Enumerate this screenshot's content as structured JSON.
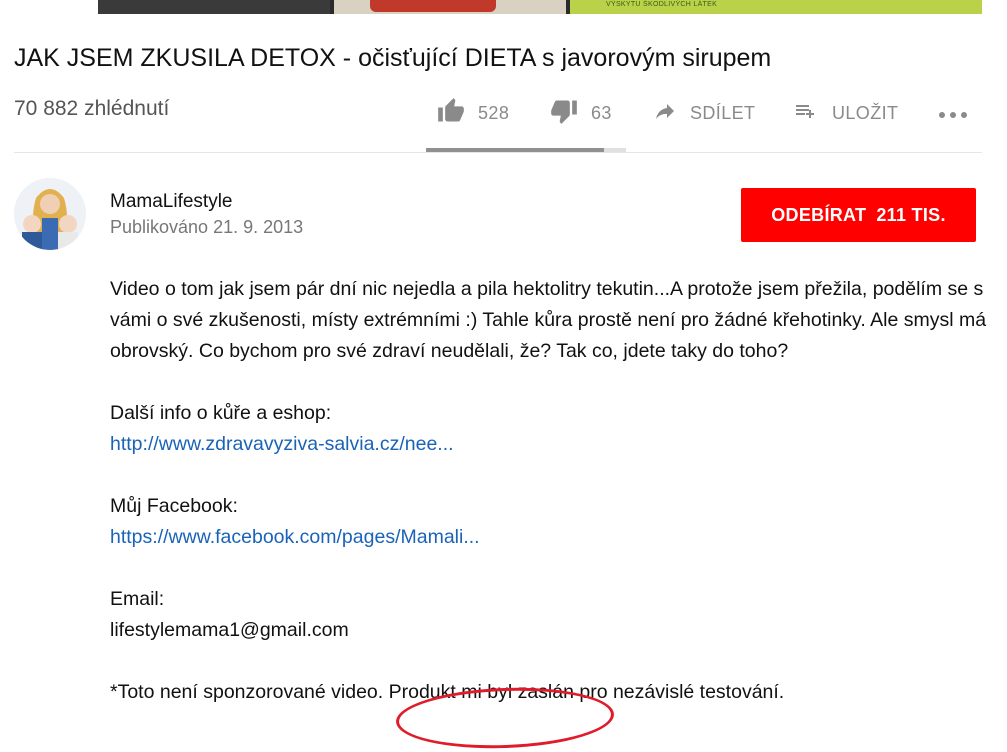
{
  "thumbnail": {
    "visible_text": "VÝSKYTU ŠKODLIVÝCH LÁTEK"
  },
  "video": {
    "title": "JAK JSEM ZKUSILA DETOX - očisťující DIETA s javorovým sirupem",
    "views": "70 882 zhlédnutí",
    "like_ratio": 0.89
  },
  "actions": {
    "like_count": "528",
    "dislike_count": "63",
    "share_label": "SDÍLET",
    "save_label": "ULOŽIT"
  },
  "channel": {
    "name": "MamaLifestyle",
    "published": "Publikováno 21. 9. 2013",
    "subscribe_label": "ODEBÍRAT",
    "subscriber_count": "211 TIS."
  },
  "description": {
    "intro": "Video o tom jak jsem pár dní nic nejedla a pila hektolitry tekutin...A protože jsem přežila, podělím se s vámi o své zkušenosti, místy extrémními :) Tahle kůra prostě není pro žádné křehotinky. Ale smysl má obrovský. Co bychom pro své zdraví neudělali, že? Tak co, jdete taky do toho?",
    "info_label": "Další info o kůře a eshop:",
    "info_link": "http://www.zdravavyziva-salvia.cz/nee...",
    "facebook_label": "Můj Facebook:",
    "facebook_link": "https://www.facebook.com/pages/Mamali...",
    "email_label": "Email:",
    "email_value": "lifestylemama1@gmail.com",
    "disclaimer": "*Toto není sponzorované video. Produkt mi byl zaslán pro nezávislé testování."
  },
  "colors": {
    "subscribe_bg": "#ff0000",
    "link": "#1a63b7",
    "annotation_circle": "#e01b2a"
  }
}
